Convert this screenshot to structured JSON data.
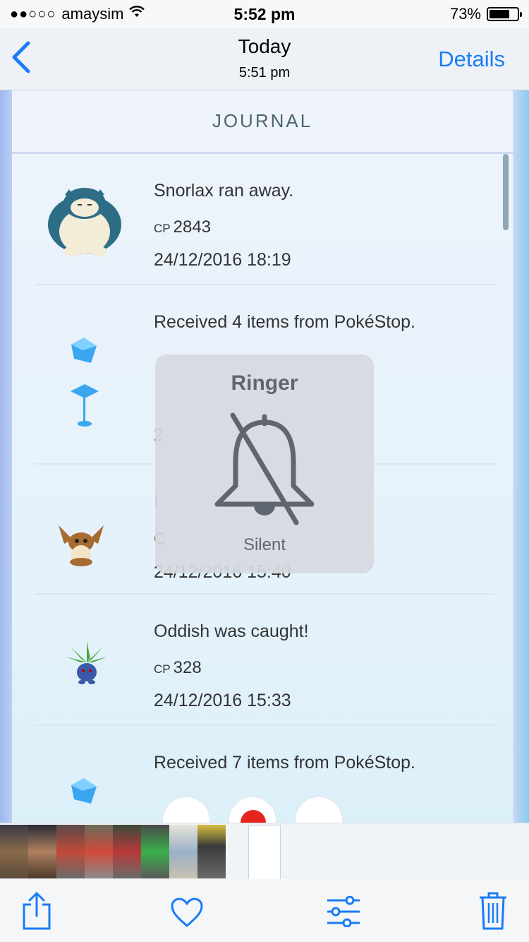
{
  "status_bar": {
    "carrier": "amaysim",
    "signal": "●●○○○",
    "time": "5:52 pm",
    "battery_percent": "73%",
    "battery_level": 0.73
  },
  "nav": {
    "title": "Today",
    "subtitle": "5:51 pm",
    "details_label": "Details"
  },
  "journal": {
    "header": "JOURNAL",
    "entries": [
      {
        "text": "Snorlax ran away.",
        "cp_label": "CP",
        "cp": "2843",
        "date": "24/12/2016 18:19"
      },
      {
        "text": "Received 4 items from PokéStop."
      },
      {
        "cp_label": "CP",
        "date": "24/12/2016 15:40"
      },
      {
        "text": "Oddish was caught!",
        "cp_label": "CP",
        "cp": "328",
        "date": "24/12/2016 15:33"
      },
      {
        "text": "Received 7 items from PokéStop."
      }
    ]
  },
  "ringer": {
    "title": "Ringer",
    "state": "Silent"
  },
  "colors": {
    "accent": "#1a7cf5",
    "journal_title": "#4a6572"
  }
}
